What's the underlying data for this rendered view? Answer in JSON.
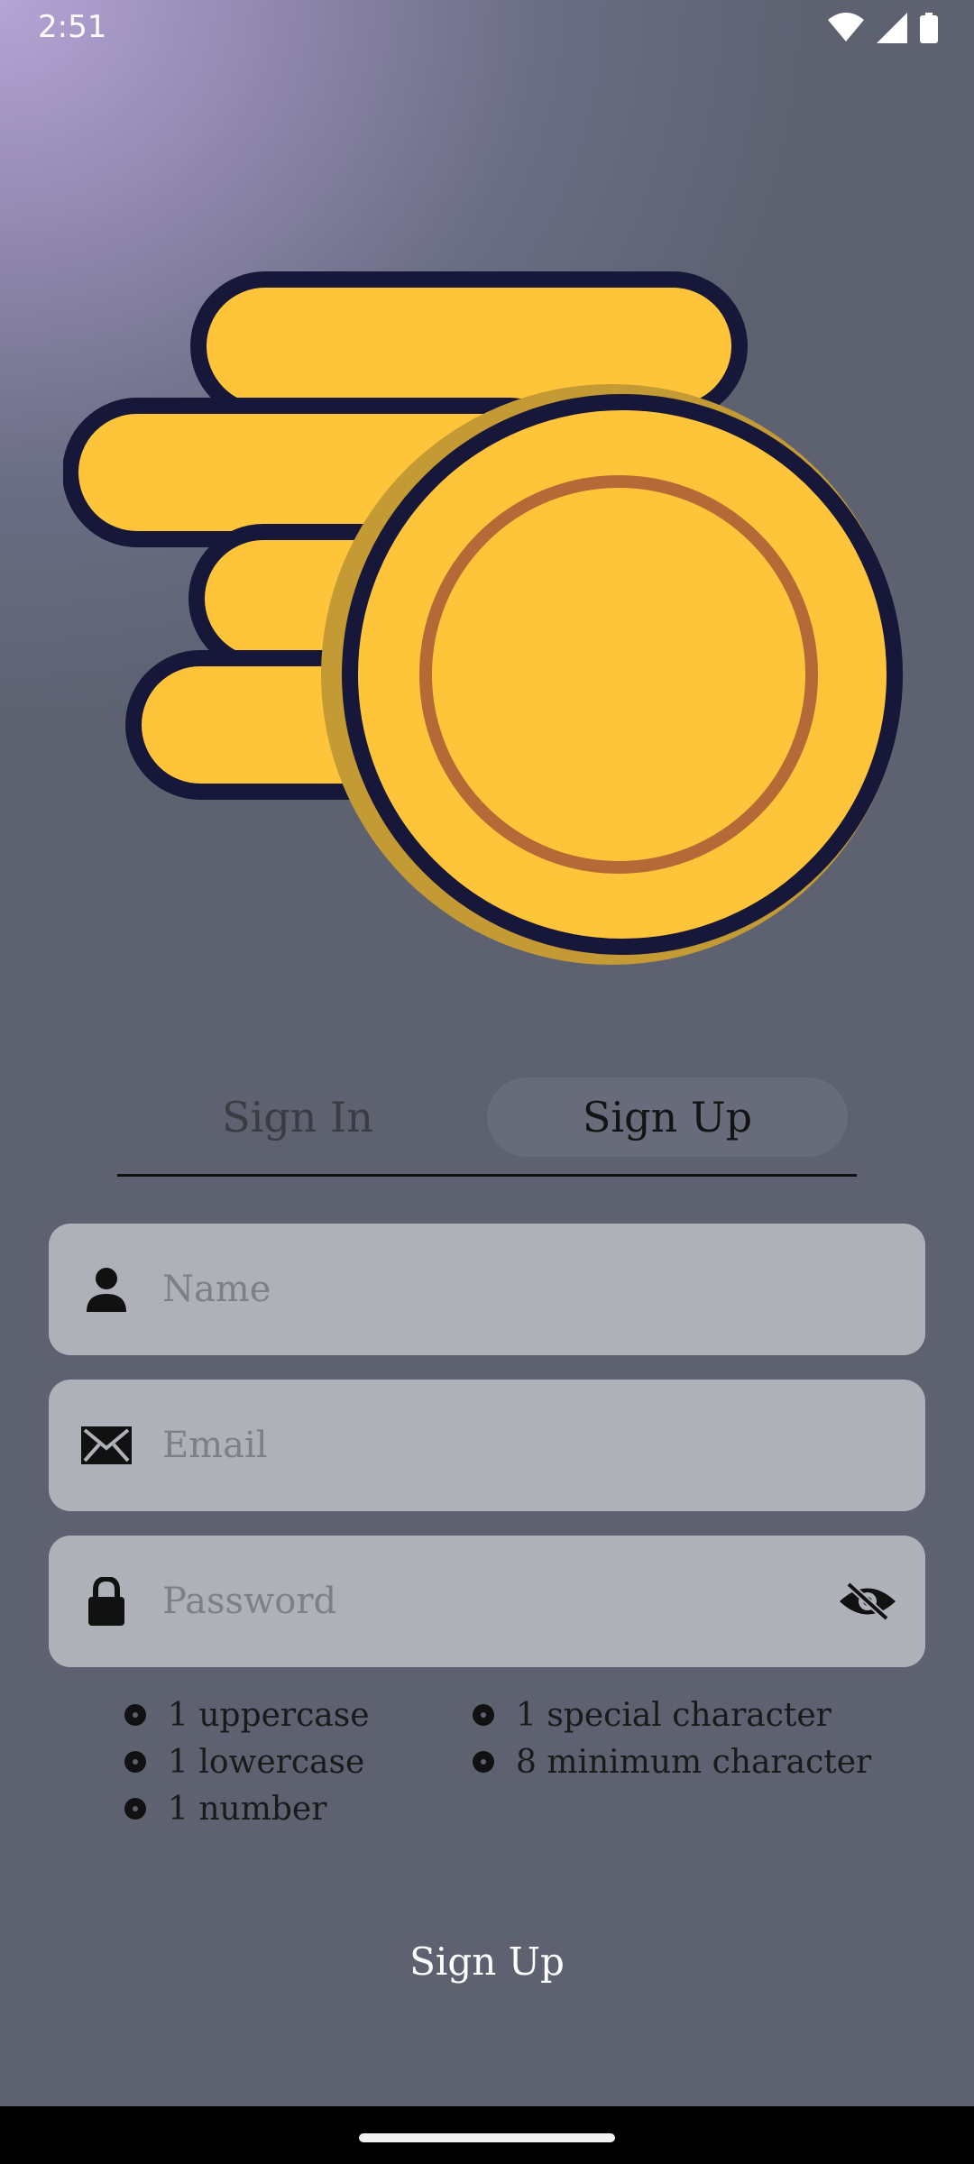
{
  "status_bar": {
    "time": "2:51",
    "icons": [
      "wifi-icon",
      "signal-icon",
      "battery-icon"
    ]
  },
  "logo": {
    "icon": "coins-stack-icon",
    "colors": {
      "fill": "#ffc53a",
      "outline": "#17173a",
      "ring": "#b56937"
    }
  },
  "tabs": [
    {
      "label": "Sign In",
      "selected": false
    },
    {
      "label": "Sign Up",
      "selected": true
    }
  ],
  "form": {
    "name": {
      "placeholder": "Name",
      "value": "",
      "icon": "person-icon"
    },
    "email": {
      "placeholder": "Email",
      "value": "",
      "icon": "envelope-icon"
    },
    "password": {
      "placeholder": "Password",
      "value": "",
      "icon": "lock-icon",
      "toggle_icon": "eye-off-icon"
    }
  },
  "password_rules": {
    "left": [
      "1 uppercase",
      "1 lowercase",
      "1 number"
    ],
    "right": [
      "1 special character",
      "8 minimum character"
    ]
  },
  "submit_label": "Sign Up"
}
